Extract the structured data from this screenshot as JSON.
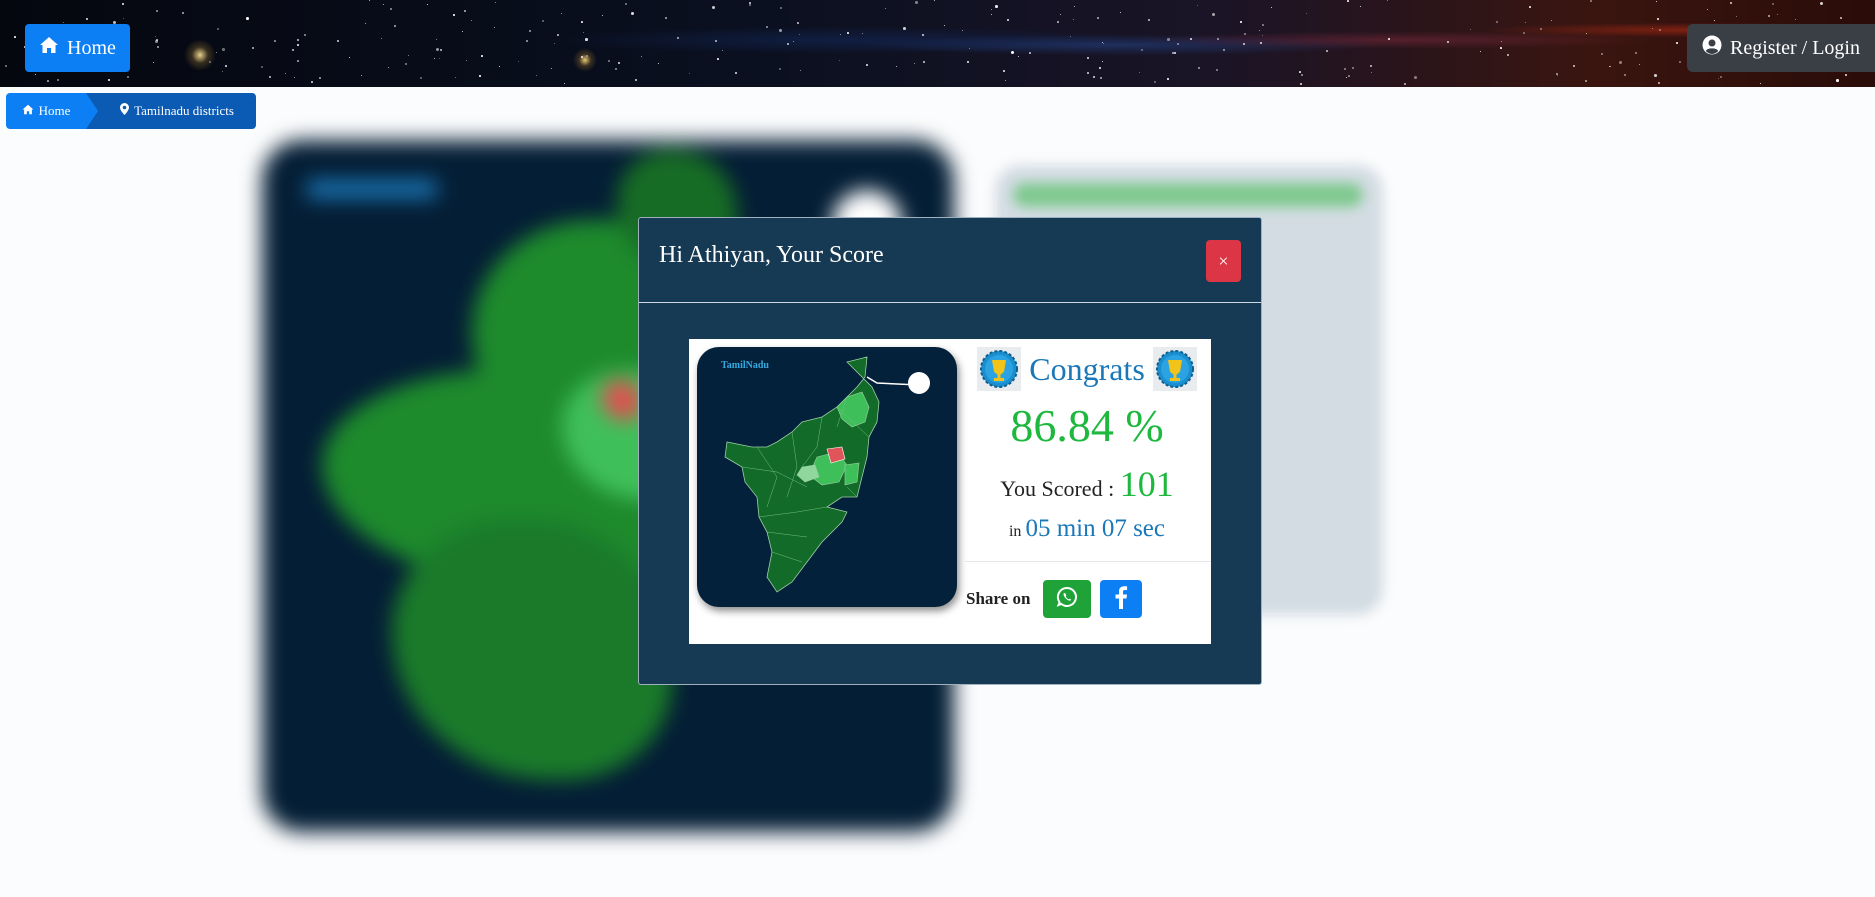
{
  "header": {
    "home_label": "Home",
    "home_icon": "home-icon",
    "login_label": "Register / Login",
    "login_icon": "user-circle-icon"
  },
  "breadcrumb": {
    "items": [
      {
        "label": "Home",
        "icon": "home-icon"
      },
      {
        "label": "Tamilnadu districts",
        "icon": "map-marker-icon"
      }
    ]
  },
  "modal": {
    "title": "Hi Athiyan, Your Score",
    "close_label": "×",
    "map_title": "TamilNadu",
    "congrats": "Congrats",
    "percent": "86.84 %",
    "scored_label": "You Scored :",
    "score": "101",
    "in_label": "in",
    "time": "05 min 07 sec",
    "share_label": "Share on",
    "share_buttons": [
      "whatsapp-icon",
      "facebook-icon"
    ]
  },
  "colors": {
    "primary": "#0d7ff5",
    "success": "#1fb83f",
    "danger": "#dc3545",
    "modal_bg": "#163a54",
    "accent_text": "#1a77b8"
  }
}
